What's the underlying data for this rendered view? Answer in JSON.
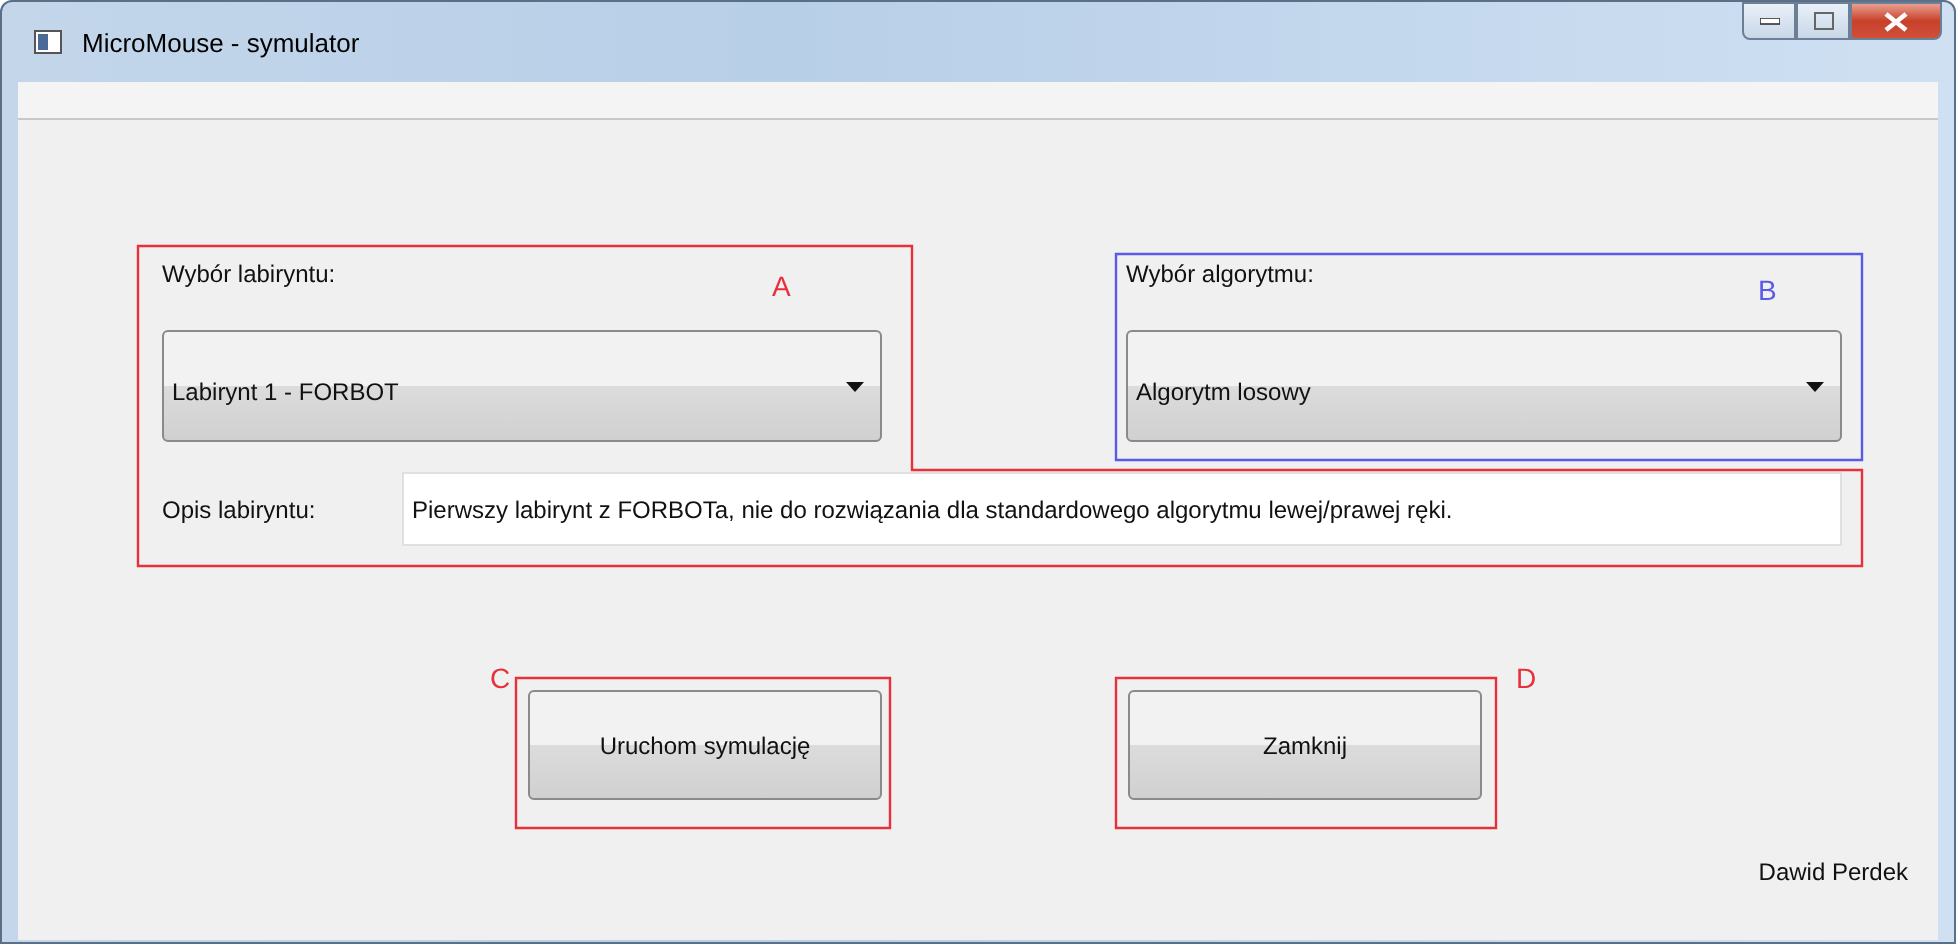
{
  "window": {
    "title": "MicroMouse - symulator"
  },
  "maze": {
    "label": "Wybór labiryntu:",
    "selected_value": "Labirynt 1 - FORBOT"
  },
  "algorithm": {
    "label": "Wybór algorytmu:",
    "selected_value": "Algorytm losowy"
  },
  "description": {
    "label": "Opis labiryntu:",
    "value": "Pierwszy labirynt z FORBOTa, nie do rozwiązania dla standardowego algorytmu lewej/prawej ręki."
  },
  "buttons": [
    "Uruchom symulację",
    "Zamknij"
  ],
  "author": "Dawid Perdek",
  "annotations": [
    {
      "label": "A",
      "color": "#e8303a"
    },
    {
      "label": "B",
      "color": "#5a5ae6"
    },
    {
      "label": "C",
      "color": "#e8303a"
    },
    {
      "label": "D",
      "color": "#e8303a"
    }
  ]
}
